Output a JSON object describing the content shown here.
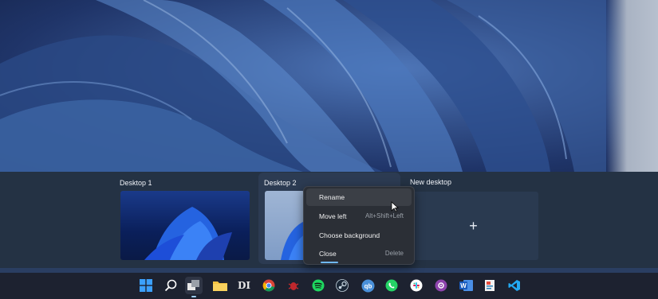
{
  "desktops": [
    {
      "label": "Desktop 1"
    },
    {
      "label": "Desktop 2"
    },
    {
      "label": "New desktop",
      "add_symbol": "+"
    }
  ],
  "context_menu": {
    "items": [
      {
        "label": "Rename",
        "shortcut": ""
      },
      {
        "label": "Move left",
        "shortcut": "Alt+Shift+Left"
      },
      {
        "label": "Choose background",
        "shortcut": ""
      },
      {
        "label": "Close",
        "shortcut": "Delete"
      }
    ]
  },
  "taskbar": {
    "icons": [
      {
        "name": "start-icon",
        "glyph": ""
      },
      {
        "name": "search-icon",
        "glyph": ""
      },
      {
        "name": "task-view-icon",
        "glyph": ""
      },
      {
        "name": "file-explorer-icon",
        "glyph": ""
      },
      {
        "name": "di-app-icon",
        "glyph": "DI"
      },
      {
        "name": "chrome-icon",
        "glyph": ""
      },
      {
        "name": "bug-app-icon",
        "glyph": ""
      },
      {
        "name": "spotify-icon",
        "glyph": ""
      },
      {
        "name": "steam-icon",
        "glyph": ""
      },
      {
        "name": "qbittorrent-icon",
        "glyph": "qb"
      },
      {
        "name": "whatsapp-icon",
        "glyph": ""
      },
      {
        "name": "slack-icon",
        "glyph": ""
      },
      {
        "name": "podcast-icon",
        "glyph": ""
      },
      {
        "name": "word-icon",
        "glyph": "W"
      },
      {
        "name": "paint-app-icon",
        "glyph": ""
      },
      {
        "name": "vscode-icon",
        "glyph": ""
      }
    ]
  },
  "colors": {
    "accent": "#70b8ff",
    "panel": "#19273a",
    "menu": "#2b2f36"
  }
}
